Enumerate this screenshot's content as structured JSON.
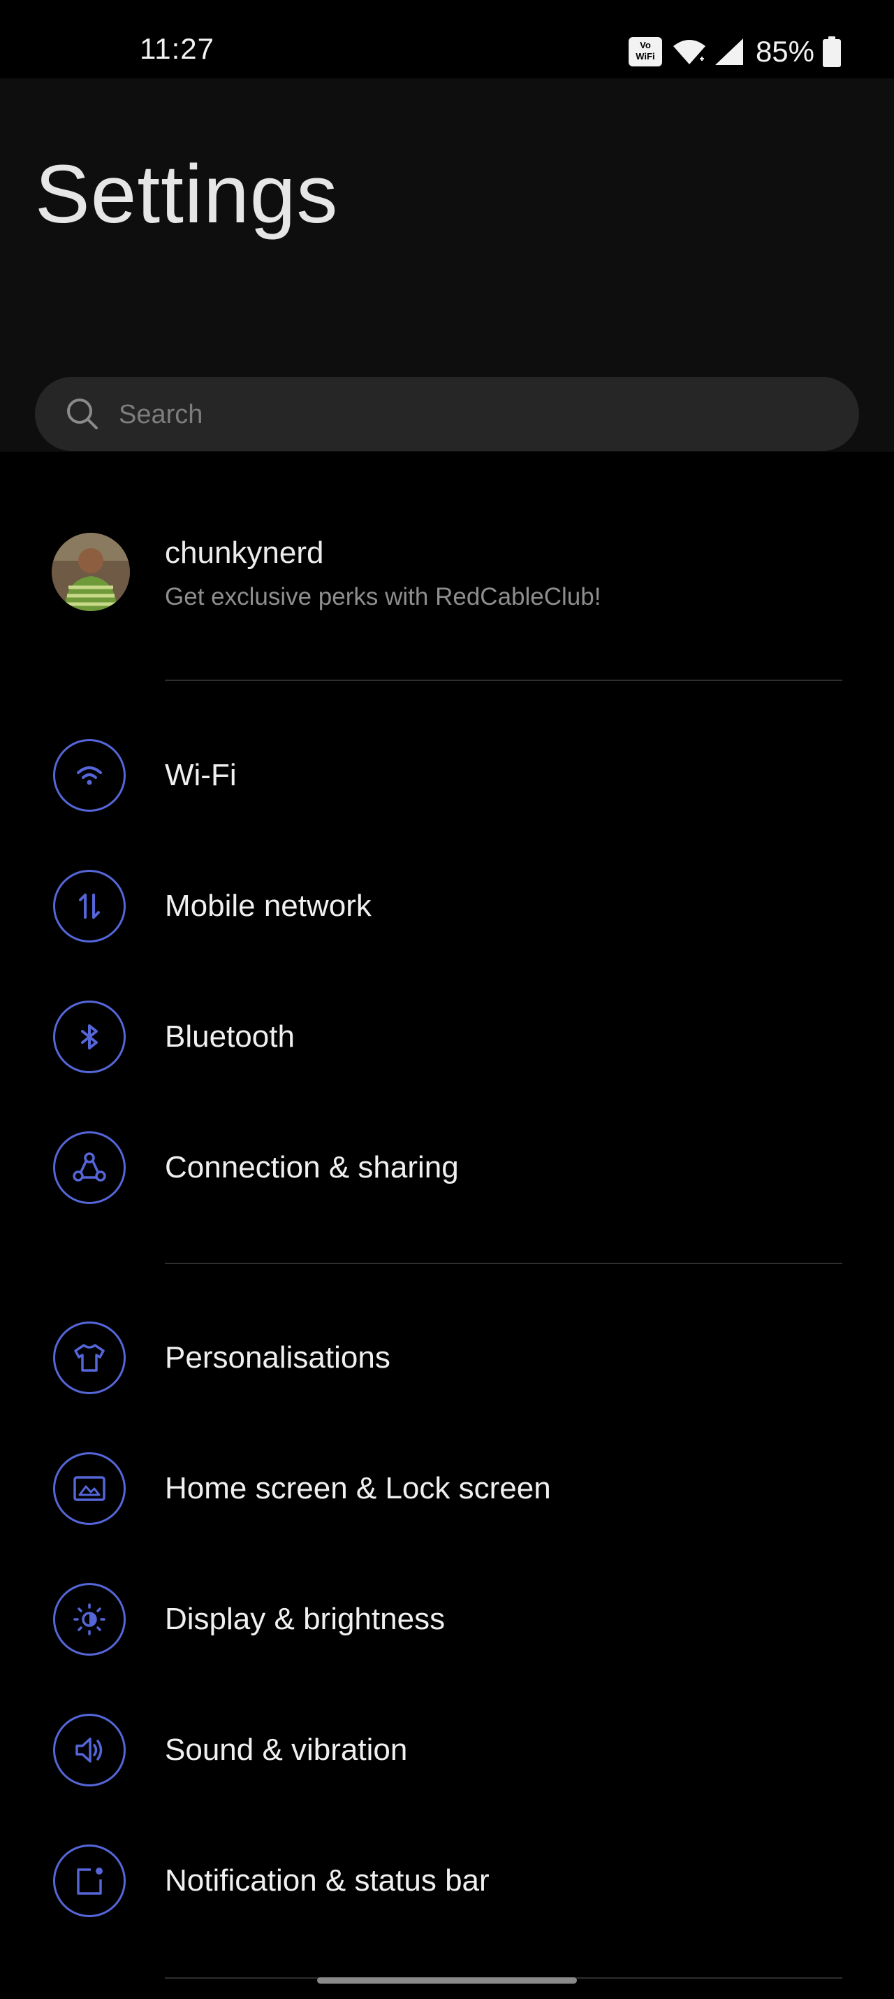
{
  "status_bar": {
    "time": "11:27",
    "vowifi_line1": "Vo",
    "vowifi_line2": "WiFi",
    "battery": "85%"
  },
  "header": {
    "title": "Settings"
  },
  "search": {
    "placeholder": "Search"
  },
  "profile": {
    "name": "chunkynerd",
    "subtitle": "Get exclusive perks with RedCableClub!"
  },
  "accent_color": "#5566d8",
  "sections": [
    {
      "items": [
        {
          "label": "Wi-Fi",
          "icon": "wifi-icon"
        },
        {
          "label": "Mobile network",
          "icon": "mobile-data-icon"
        },
        {
          "label": "Bluetooth",
          "icon": "bluetooth-icon"
        },
        {
          "label": "Connection & sharing",
          "icon": "connection-sharing-icon"
        }
      ]
    },
    {
      "items": [
        {
          "label": "Personalisations",
          "icon": "tshirt-icon"
        },
        {
          "label": "Home screen & Lock screen",
          "icon": "image-icon"
        },
        {
          "label": "Display & brightness",
          "icon": "brightness-icon"
        },
        {
          "label": "Sound & vibration",
          "icon": "speaker-icon"
        },
        {
          "label": "Notification & status bar",
          "icon": "notification-icon"
        }
      ]
    }
  ]
}
